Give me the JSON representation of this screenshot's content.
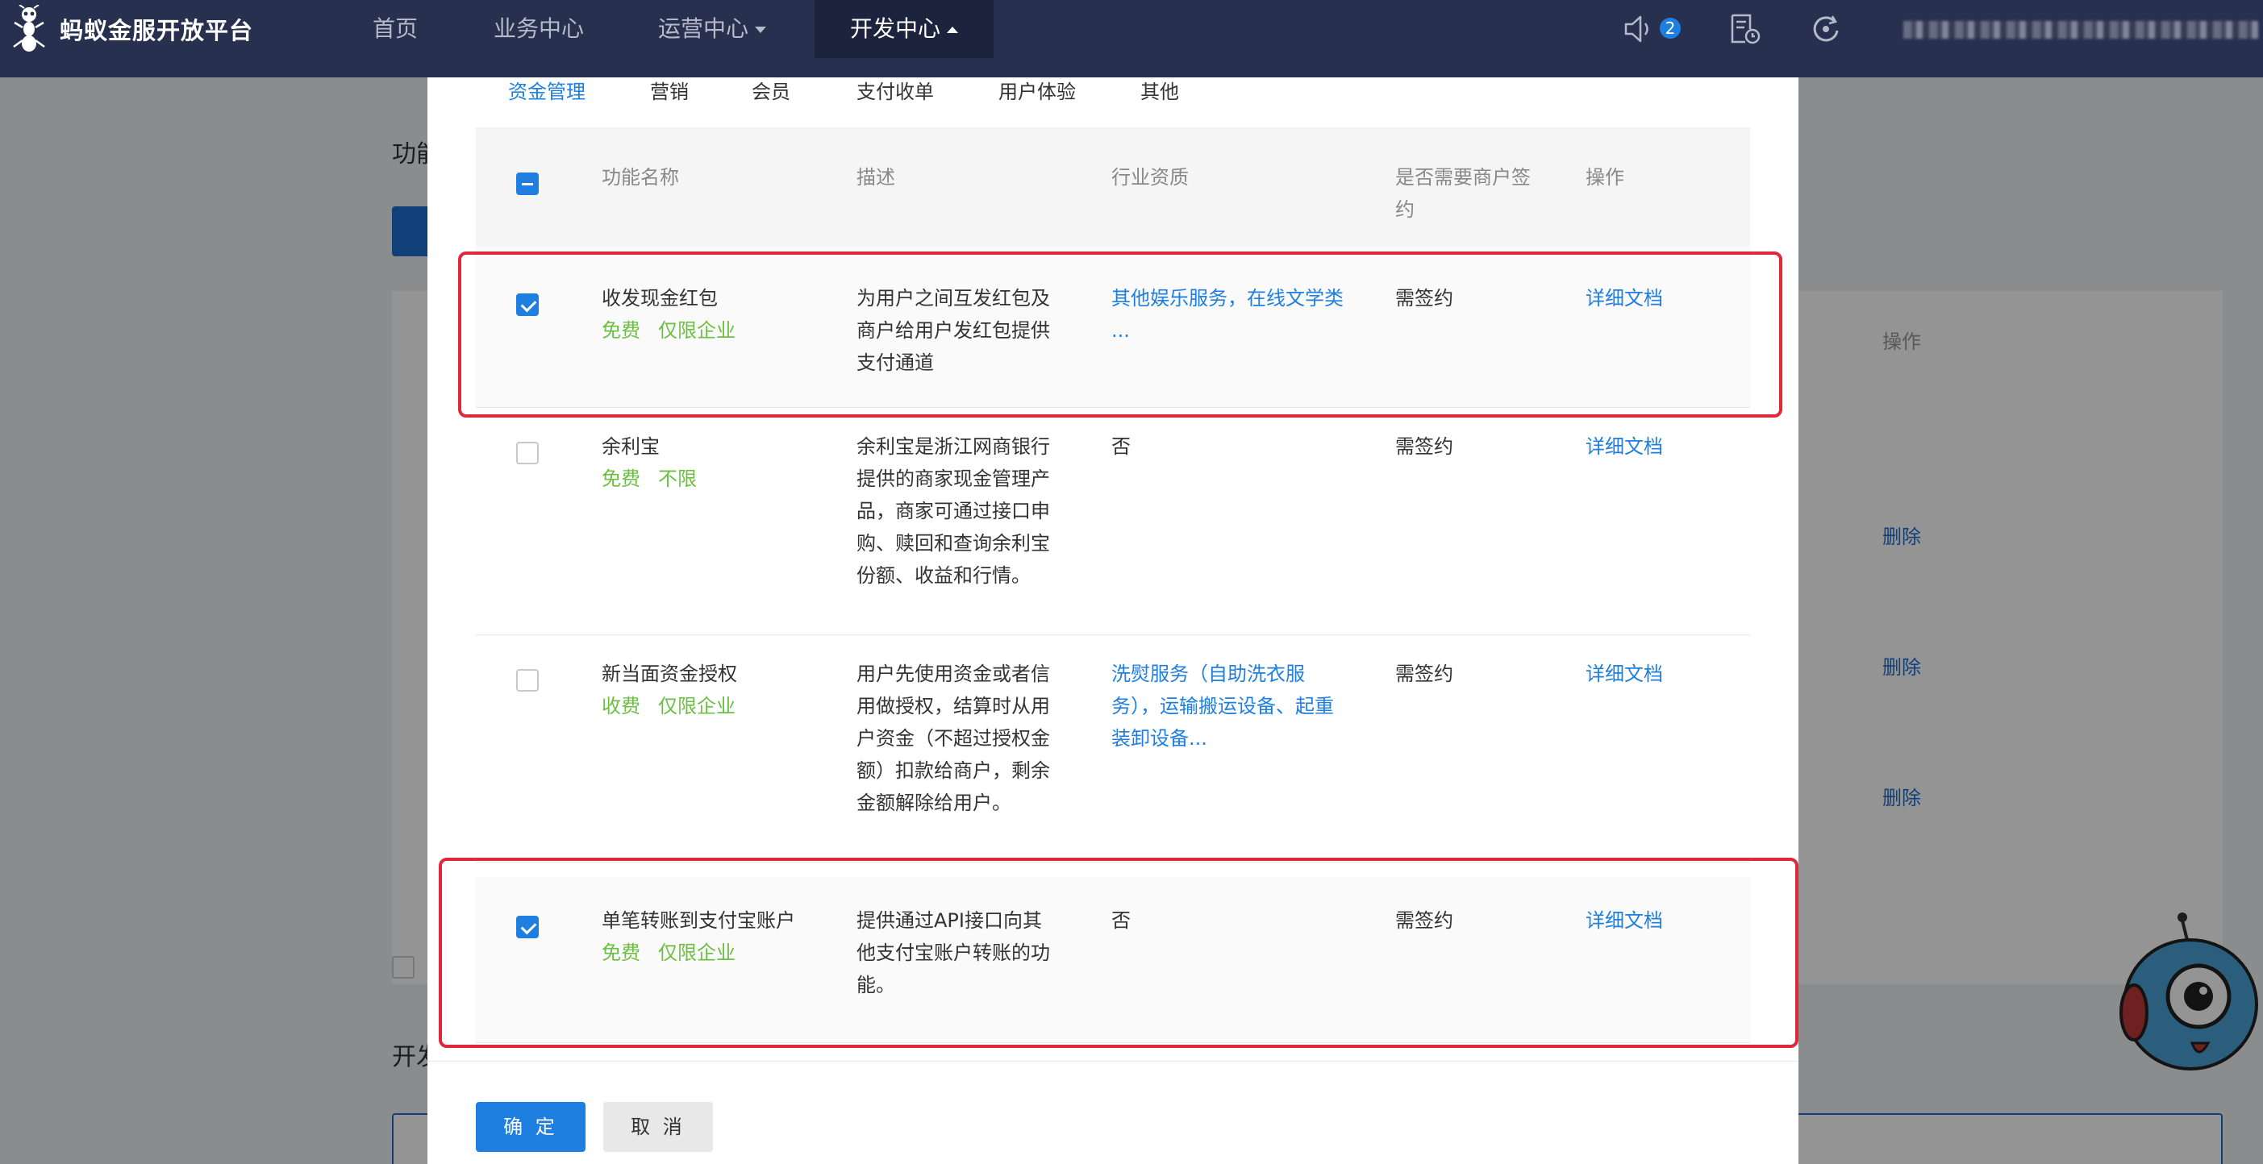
{
  "app": {
    "brand": "蚂蚁金服开放平台",
    "nav": [
      {
        "label": "首页",
        "active": false
      },
      {
        "label": "业务中心",
        "active": false
      },
      {
        "label": "运营中心",
        "active": false,
        "dropdown": true
      },
      {
        "label": "开发中心",
        "active": true,
        "dropdown": true
      }
    ],
    "notification_count": "2",
    "icons": [
      "ant-logo-icon",
      "speaker-icon",
      "document-clock-icon",
      "refresh-icon"
    ]
  },
  "background": {
    "heading_1": "功能",
    "heading_2": "开发",
    "op_header": "操作",
    "delete_label": "删除"
  },
  "modal": {
    "tabs": [
      {
        "label": "资金管理",
        "active": true
      },
      {
        "label": "营销",
        "active": false
      },
      {
        "label": "会员",
        "active": false
      },
      {
        "label": "支付收单",
        "active": false
      },
      {
        "label": "用户体验",
        "active": false
      },
      {
        "label": "其他",
        "active": false
      }
    ],
    "columns": {
      "name": "功能名称",
      "desc": "描述",
      "industry": "行业资质",
      "sign_line1": "是否需要商户签",
      "sign_line2": "约",
      "op": "操作"
    },
    "rows": [
      {
        "checked": true,
        "name": "收发现金红包",
        "fee": "免费",
        "scope": "仅限企业",
        "desc": [
          "为用户之间互发红包及",
          "商户给用户发红包提供",
          "支付通道"
        ],
        "industry": [
          "其他娱乐服务，在线文学类",
          "..."
        ],
        "industry_is_link": true,
        "sign": "需签约",
        "op": "详细文档"
      },
      {
        "checked": false,
        "name": "余利宝",
        "fee": "免费",
        "scope": "不限",
        "desc": [
          "余利宝是浙江网商银行",
          "提供的商家现金管理产",
          "品，商家可通过接口申",
          "购、赎回和查询余利宝",
          "份额、收益和行情。"
        ],
        "industry": [
          "否"
        ],
        "industry_is_link": false,
        "sign": "需签约",
        "op": "详细文档"
      },
      {
        "checked": false,
        "name": "新当面资金授权",
        "fee": "收费",
        "scope": "仅限企业",
        "desc": [
          "用户先使用资金或者信",
          "用做授权，结算时从用",
          "户资金（不超过授权金",
          "额）扣款给商户，剩余",
          "金额解除给用户。"
        ],
        "industry": [
          "洗熨服务（自助洗衣服",
          "务），运输搬运设备、起重",
          "装卸设备..."
        ],
        "industry_is_link": true,
        "sign": "需签约",
        "op": "详细文档"
      },
      {
        "checked": true,
        "name": "单笔转账到支付宝账户",
        "fee": "免费",
        "scope": "仅限企业",
        "desc": [
          "提供通过API接口向其",
          "他支付宝账户转账的功",
          "能。"
        ],
        "industry": [
          "否"
        ],
        "industry_is_link": false,
        "sign": "需签约",
        "op": "详细文档"
      }
    ],
    "confirm_label": "确 定",
    "cancel_label": "取 消"
  },
  "colors": {
    "nav_bg": "#283050",
    "accent": "#1e7fe0",
    "tag_green": "#6cbf43",
    "highlight_red": "#e0283a"
  }
}
